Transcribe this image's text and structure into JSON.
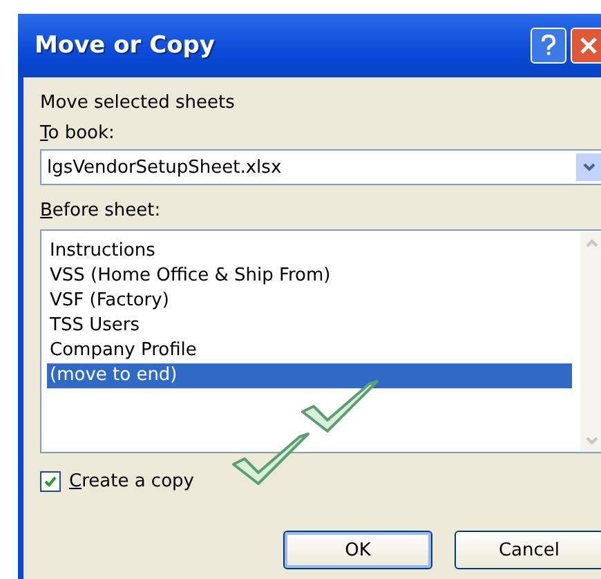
{
  "window": {
    "title": "Move or Copy"
  },
  "heading": "Move selected sheets",
  "to_book": {
    "label": "To book:",
    "value": "lgsVendorSetupSheet.xlsx"
  },
  "before_sheet": {
    "label": "Before sheet:",
    "items": [
      {
        "label": "Instructions",
        "selected": false
      },
      {
        "label": "VSS (Home Office & Ship From)",
        "selected": false
      },
      {
        "label": "VSF (Factory)",
        "selected": false
      },
      {
        "label": "TSS Users",
        "selected": false
      },
      {
        "label": "Company Profile",
        "selected": false
      },
      {
        "label": "(move to end)",
        "selected": true
      }
    ]
  },
  "create_copy": {
    "label": "Create a copy",
    "checked": true
  },
  "buttons": [
    "OK",
    "Cancel"
  ]
}
